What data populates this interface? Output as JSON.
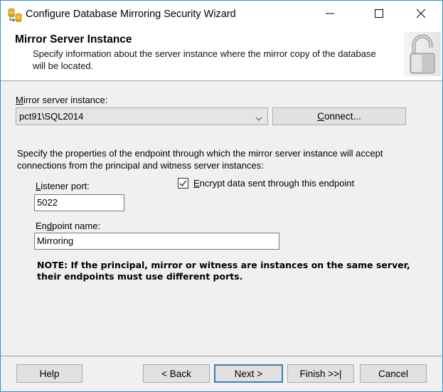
{
  "window": {
    "title": "Configure Database Mirroring Security Wizard",
    "app_icon": "database-mirroring-icon",
    "controls": {
      "minimize": "minimize-icon",
      "maximize": "maximize-icon",
      "close": "close-icon"
    }
  },
  "header": {
    "title": "Mirror Server Instance",
    "description": "Specify information about the server instance where the mirror copy of the database will be located.",
    "icon": "padlock-open-icon"
  },
  "mirror_instance": {
    "label_mnemonic": "M",
    "label_rest": "irror server instance:",
    "value": "pct91\\SQL2014",
    "connect_mnemonic": "C",
    "connect_rest": "onnect..."
  },
  "endpoint": {
    "description": "Specify the properties of the endpoint through which the mirror server instance will accept connections from the principal and witness server instances:",
    "listener_port_mnemonic": "L",
    "listener_port_rest": "istener port:",
    "listener_port_value": "5022",
    "encrypt_mnemonic": "E",
    "encrypt_rest": "ncrypt data sent through this endpoint",
    "encrypt_checked": true,
    "endpoint_name_pre": "En",
    "endpoint_name_mnemonic": "d",
    "endpoint_name_rest": "point name:",
    "endpoint_name_value": "Mirroring",
    "note": "NOTE: If the principal, mirror or witness are instances on the same server, their endpoints must use different ports."
  },
  "footer": {
    "help": "Help",
    "back": "< Back",
    "next": "Next >",
    "finish": "Finish >>|",
    "cancel": "Cancel"
  }
}
